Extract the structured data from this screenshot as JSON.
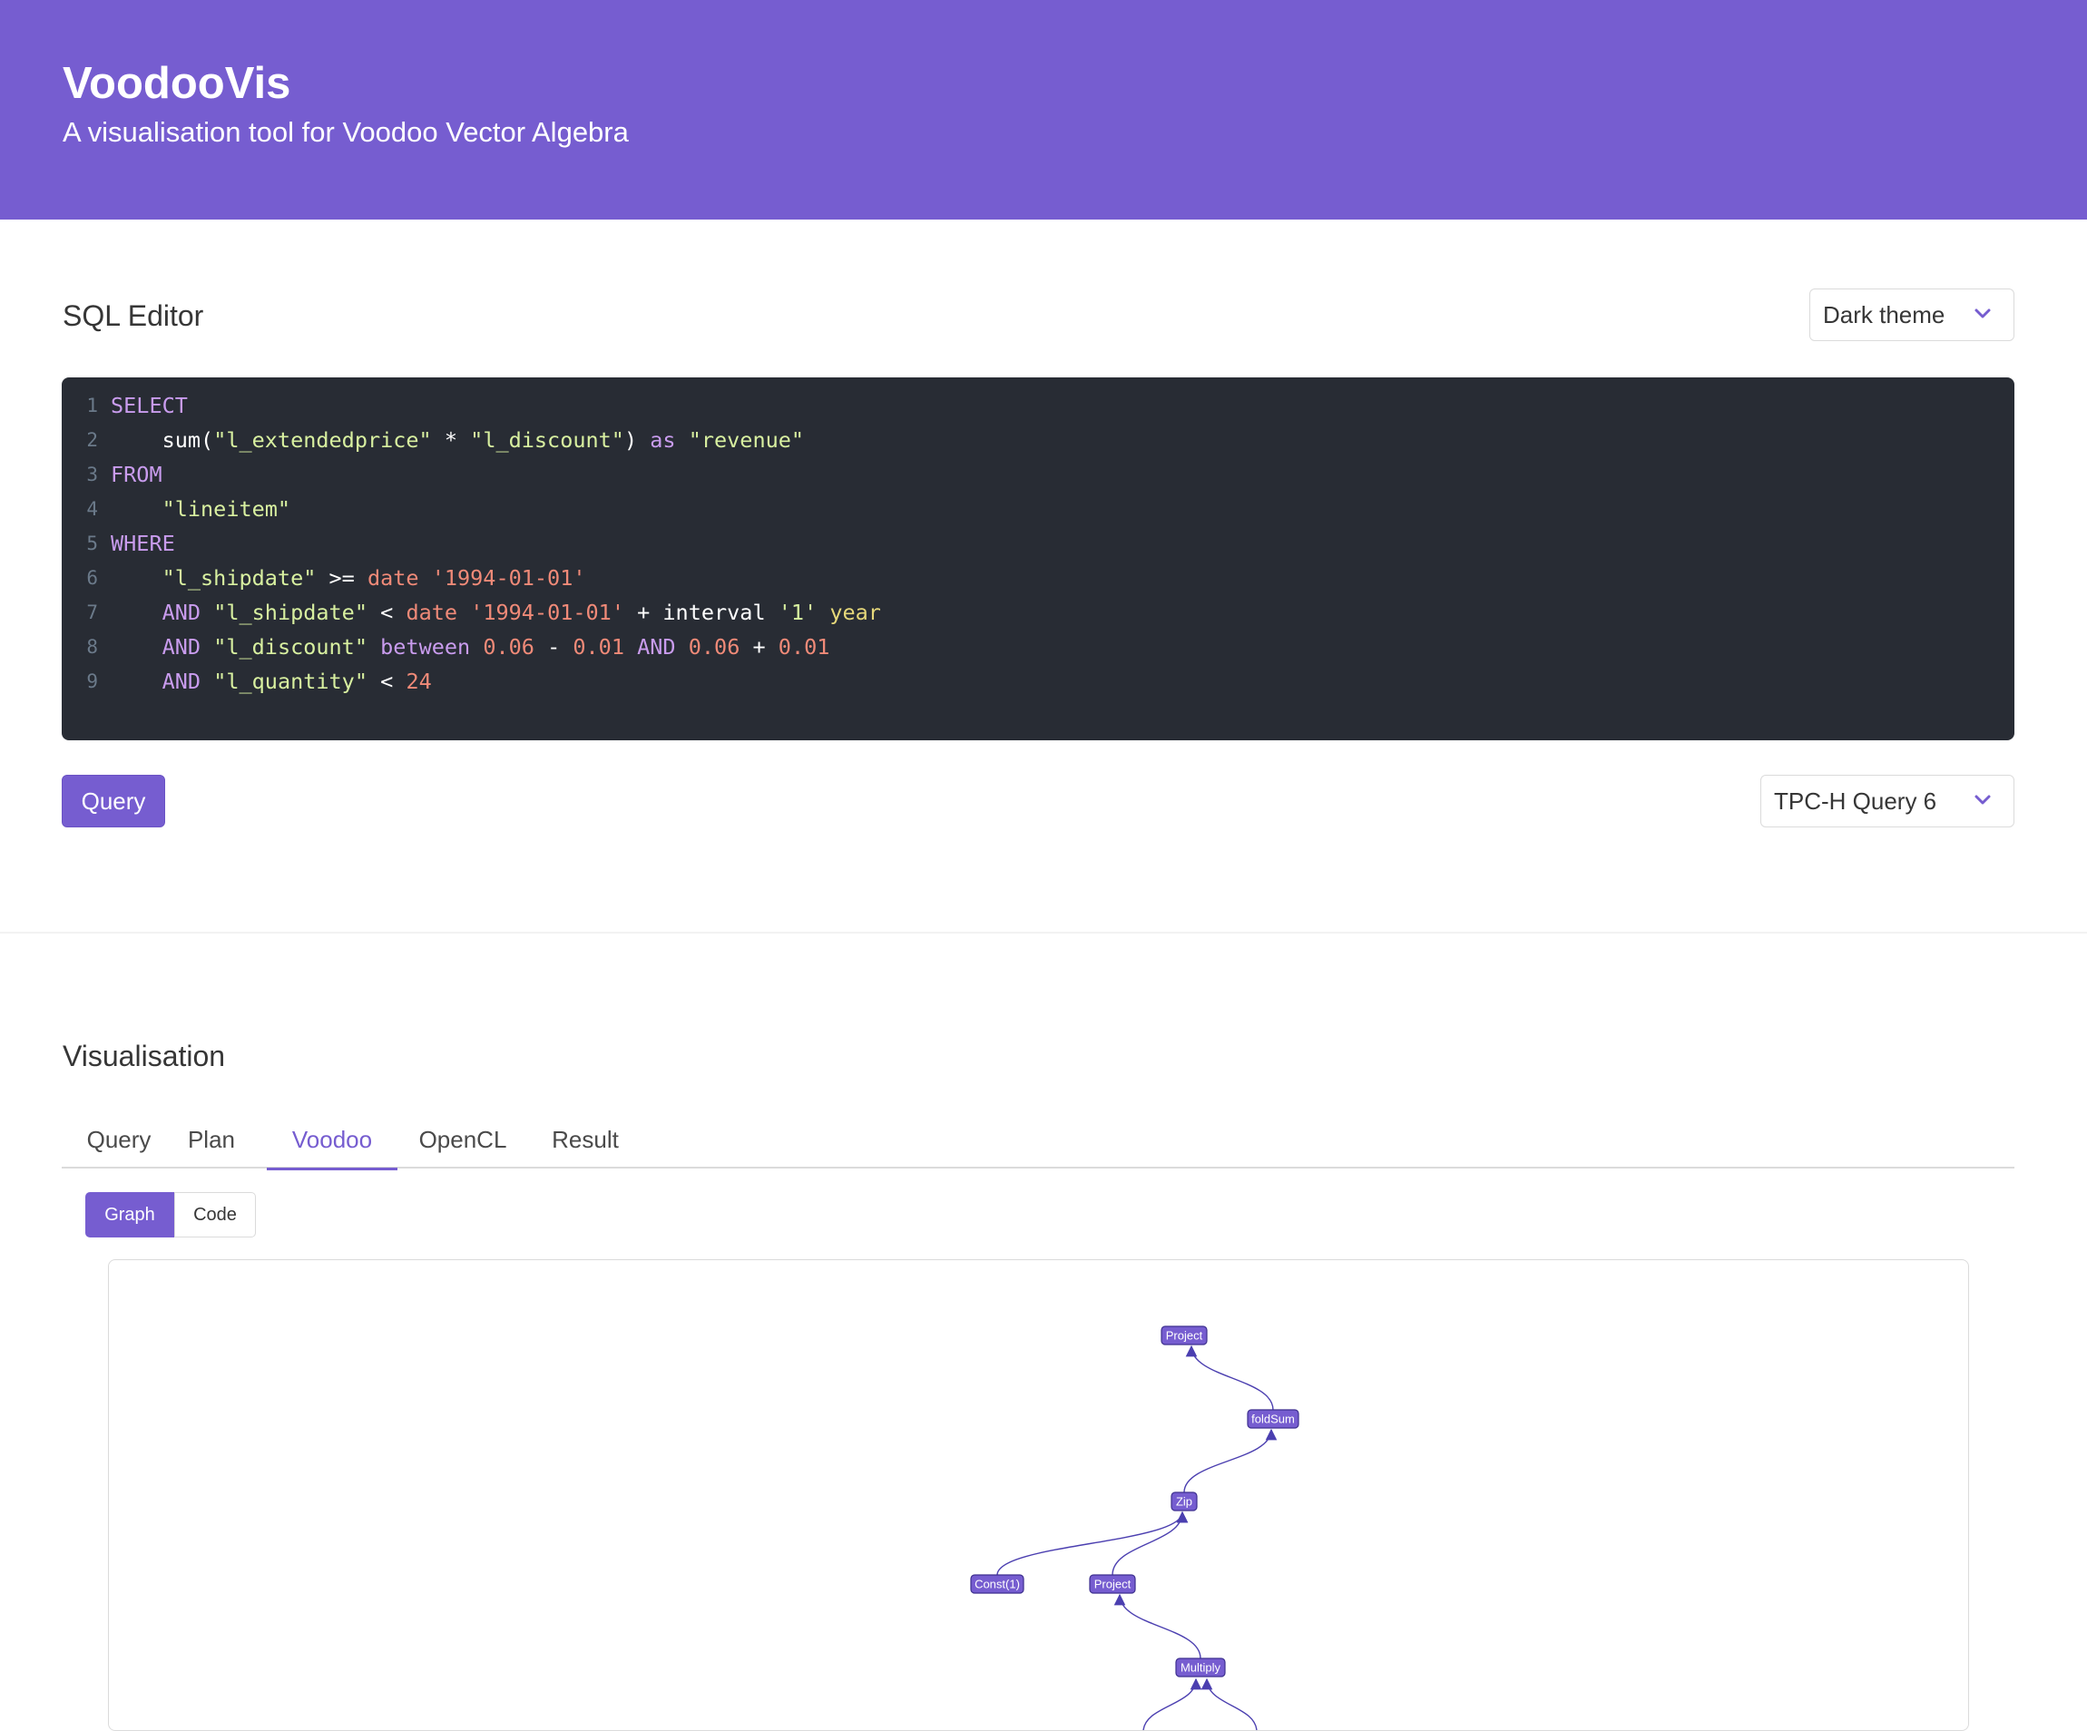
{
  "header": {
    "title": "VoodooVis",
    "subtitle": "A visualisation tool for Voodoo Vector Algebra"
  },
  "editor_section": {
    "title": "SQL Editor",
    "theme_select": "Dark theme",
    "query_button": "Query",
    "query_select": "TPC-H Query 6"
  },
  "sql": {
    "line_numbers": [
      "1",
      "2",
      "3",
      "4",
      "5",
      "6",
      "7",
      "8",
      "9"
    ],
    "lines": [
      [
        {
          "t": "SELECT",
          "c": "kw"
        }
      ],
      [
        {
          "t": "    sum(",
          "c": "fn"
        },
        {
          "t": "\"l_extendedprice\"",
          "c": "str"
        },
        {
          "t": " * ",
          "c": "fn"
        },
        {
          "t": "\"l_discount\"",
          "c": "str"
        },
        {
          "t": ") ",
          "c": "fn"
        },
        {
          "t": "as",
          "c": "kw"
        },
        {
          "t": " ",
          "c": "fn"
        },
        {
          "t": "\"revenue\"",
          "c": "str"
        }
      ],
      [
        {
          "t": "FROM",
          "c": "kw"
        }
      ],
      [
        {
          "t": "    ",
          "c": "fn"
        },
        {
          "t": "\"lineitem\"",
          "c": "str"
        }
      ],
      [
        {
          "t": "WHERE",
          "c": "kw"
        }
      ],
      [
        {
          "t": "    ",
          "c": "fn"
        },
        {
          "t": "\"l_shipdate\"",
          "c": "str"
        },
        {
          "t": " >= ",
          "c": "fn"
        },
        {
          "t": "date",
          "c": "num"
        },
        {
          "t": " ",
          "c": "fn"
        },
        {
          "t": "'1994-01-01'",
          "c": "num"
        }
      ],
      [
        {
          "t": "    ",
          "c": "fn"
        },
        {
          "t": "AND",
          "c": "kw"
        },
        {
          "t": " ",
          "c": "fn"
        },
        {
          "t": "\"l_shipdate\"",
          "c": "str"
        },
        {
          "t": " < ",
          "c": "fn"
        },
        {
          "t": "date",
          "c": "num"
        },
        {
          "t": " ",
          "c": "fn"
        },
        {
          "t": "'1994-01-01'",
          "c": "num"
        },
        {
          "t": " + interval ",
          "c": "fn"
        },
        {
          "t": "'1'",
          "c": "str"
        },
        {
          "t": " ",
          "c": "fn"
        },
        {
          "t": "year",
          "c": "yr"
        }
      ],
      [
        {
          "t": "    ",
          "c": "fn"
        },
        {
          "t": "AND",
          "c": "kw"
        },
        {
          "t": " ",
          "c": "fn"
        },
        {
          "t": "\"l_discount\"",
          "c": "str"
        },
        {
          "t": " ",
          "c": "fn"
        },
        {
          "t": "between",
          "c": "kw"
        },
        {
          "t": " ",
          "c": "fn"
        },
        {
          "t": "0.06",
          "c": "num"
        },
        {
          "t": " - ",
          "c": "fn"
        },
        {
          "t": "0.01",
          "c": "num"
        },
        {
          "t": " ",
          "c": "fn"
        },
        {
          "t": "AND",
          "c": "kw"
        },
        {
          "t": " ",
          "c": "fn"
        },
        {
          "t": "0.06",
          "c": "num"
        },
        {
          "t": " + ",
          "c": "fn"
        },
        {
          "t": "0.01",
          "c": "num"
        }
      ],
      [
        {
          "t": "    ",
          "c": "fn"
        },
        {
          "t": "AND",
          "c": "kw"
        },
        {
          "t": " ",
          "c": "fn"
        },
        {
          "t": "\"l_quantity\"",
          "c": "str"
        },
        {
          "t": " < ",
          "c": "fn"
        },
        {
          "t": "24",
          "c": "num"
        }
      ]
    ]
  },
  "visualisation": {
    "title": "Visualisation",
    "tabs": [
      "Query",
      "Plan",
      "Voodoo",
      "OpenCL",
      "Result"
    ],
    "active_tab": "Voodoo",
    "view_buttons": [
      "Graph",
      "Code"
    ],
    "active_view": "Graph"
  },
  "graph": {
    "nodes": [
      {
        "id": "n1",
        "label": "Project"
      },
      {
        "id": "n2",
        "label": "foldSum"
      },
      {
        "id": "n3",
        "label": "Zip"
      },
      {
        "id": "n4",
        "label": "Const(1)"
      },
      {
        "id": "n5",
        "label": "Project"
      },
      {
        "id": "n6",
        "label": "Multiply"
      }
    ],
    "edges": [
      {
        "from": "n2",
        "to": "n1"
      },
      {
        "from": "n3",
        "to": "n2"
      },
      {
        "from": "n4",
        "to": "n3"
      },
      {
        "from": "n5",
        "to": "n3"
      },
      {
        "from": "n6",
        "to": "n5"
      }
    ]
  },
  "colors": {
    "accent": "#765dd0",
    "editor_bg": "#282c34",
    "edge": "#4b3fb0"
  }
}
